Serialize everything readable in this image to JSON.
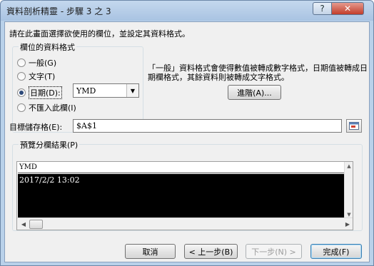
{
  "window": {
    "title": "資料剖析精靈 - 步驟 3 之 3",
    "help_icon": "?",
    "close_icon": "✕"
  },
  "instruction": "請在此畫面選擇欲使用的欄位，並設定其資料格式。",
  "column_format": {
    "group_title": "欄位的資料格式",
    "options": [
      {
        "label": "一般(G)",
        "checked": false
      },
      {
        "label": "文字(T)",
        "checked": false
      },
      {
        "label": "日期(D):",
        "checked": true
      },
      {
        "label": "不匯入此欄(I)",
        "checked": false
      }
    ],
    "date_format_value": "YMD"
  },
  "description": "「一般」資料格式會使得數值被轉成數字格式，日期值被轉成日期欄格式，其餘資料則被轉成文字格式。",
  "advanced_button": "進階(A)...",
  "destination": {
    "label": "目標儲存格(E):",
    "value": "$A$1"
  },
  "preview": {
    "group_title": "預覽分欄結果(P)",
    "column_header": "YMD",
    "rows": [
      "2017/2/2 13:02"
    ]
  },
  "buttons": {
    "cancel": "取消",
    "back": "< 上一步(B)",
    "next": "下一步(N) >",
    "finish": "完成(F)"
  }
}
